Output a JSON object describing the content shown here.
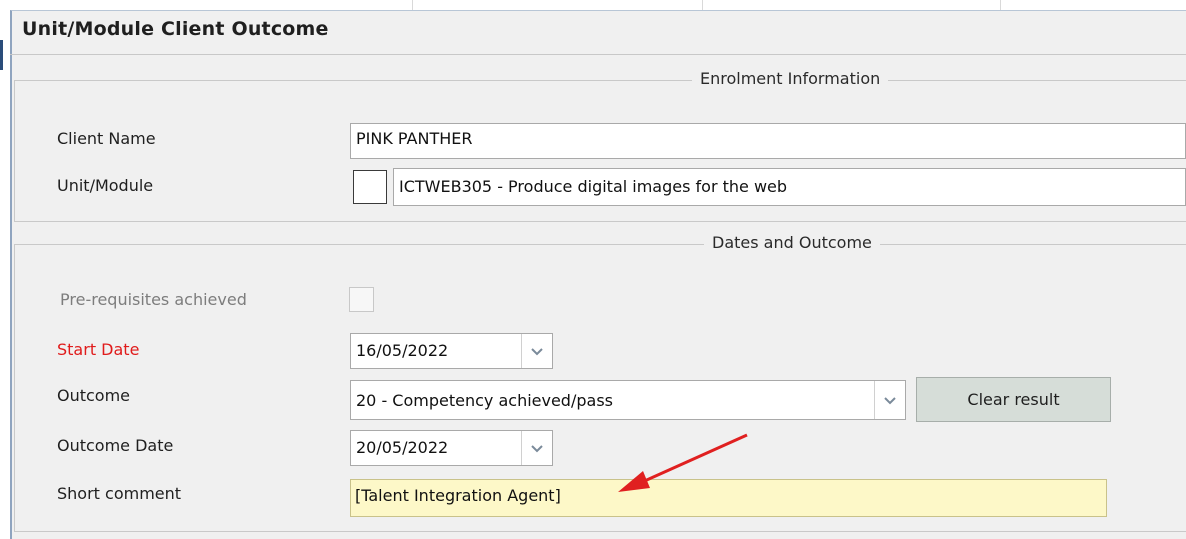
{
  "window": {
    "title": "Unit/Module Client Outcome"
  },
  "enrolment": {
    "legend": "Enrolment Information",
    "client_name_label": "Client Name",
    "client_name_value": "PINK PANTHER",
    "unit_label": "Unit/Module",
    "unit_value": "ICTWEB305 - Produce digital images for the web"
  },
  "dates": {
    "legend": "Dates and Outcome",
    "prereq_label": "Pre-requisites achieved",
    "start_label": "Start Date",
    "start_value": "16/05/2022",
    "outcome_label": "Outcome",
    "outcome_value": "20 - Competency achieved/pass",
    "clear_button": "Clear result",
    "outcome_date_label": "Outcome Date",
    "outcome_date_value": "20/05/2022",
    "comment_label": "Short comment",
    "comment_value": "[Talent Integration Agent]"
  },
  "colors": {
    "required_label": "#e01b1b",
    "annotation_arrow": "#e02020",
    "comment_bg": "#fdf8c8"
  }
}
